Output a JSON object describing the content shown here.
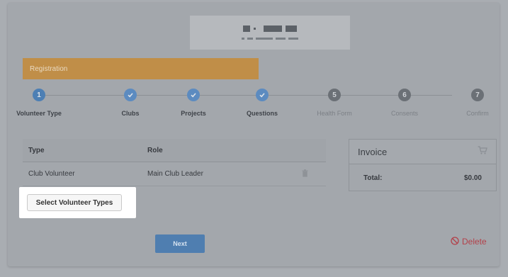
{
  "registration": {
    "label": "Registration"
  },
  "steps": [
    {
      "number": "1",
      "label": "Volunteer Type",
      "state": "current"
    },
    {
      "number": "2",
      "label": "Clubs",
      "state": "complete"
    },
    {
      "number": "3",
      "label": "Projects",
      "state": "complete"
    },
    {
      "number": "4",
      "label": "Questions",
      "state": "complete"
    },
    {
      "number": "5",
      "label": "Health Form",
      "state": "upcoming"
    },
    {
      "number": "6",
      "label": "Consents",
      "state": "upcoming"
    },
    {
      "number": "7",
      "label": "Confirm",
      "state": "upcoming"
    }
  ],
  "volunteer_table": {
    "headers": [
      "Type",
      "Role"
    ],
    "rows": [
      {
        "type": "Club Volunteer",
        "role": "Main Club Leader",
        "action_icon": "trash-icon"
      }
    ]
  },
  "select_button": {
    "label": "Select Volunteer Types"
  },
  "invoice": {
    "title": "Invoice",
    "icon": "cart-icon",
    "total_label": "Total:",
    "total_value": "$0.00"
  },
  "actions": {
    "next_label": "Next",
    "delete_label": "Delete"
  },
  "colors": {
    "accent_orange": "#c08e48",
    "step_blue": "#5c8bc0",
    "primary_button": "#4f7eb0",
    "delete_red": "#b3414a",
    "overlay_gray": "#a9adb2"
  }
}
